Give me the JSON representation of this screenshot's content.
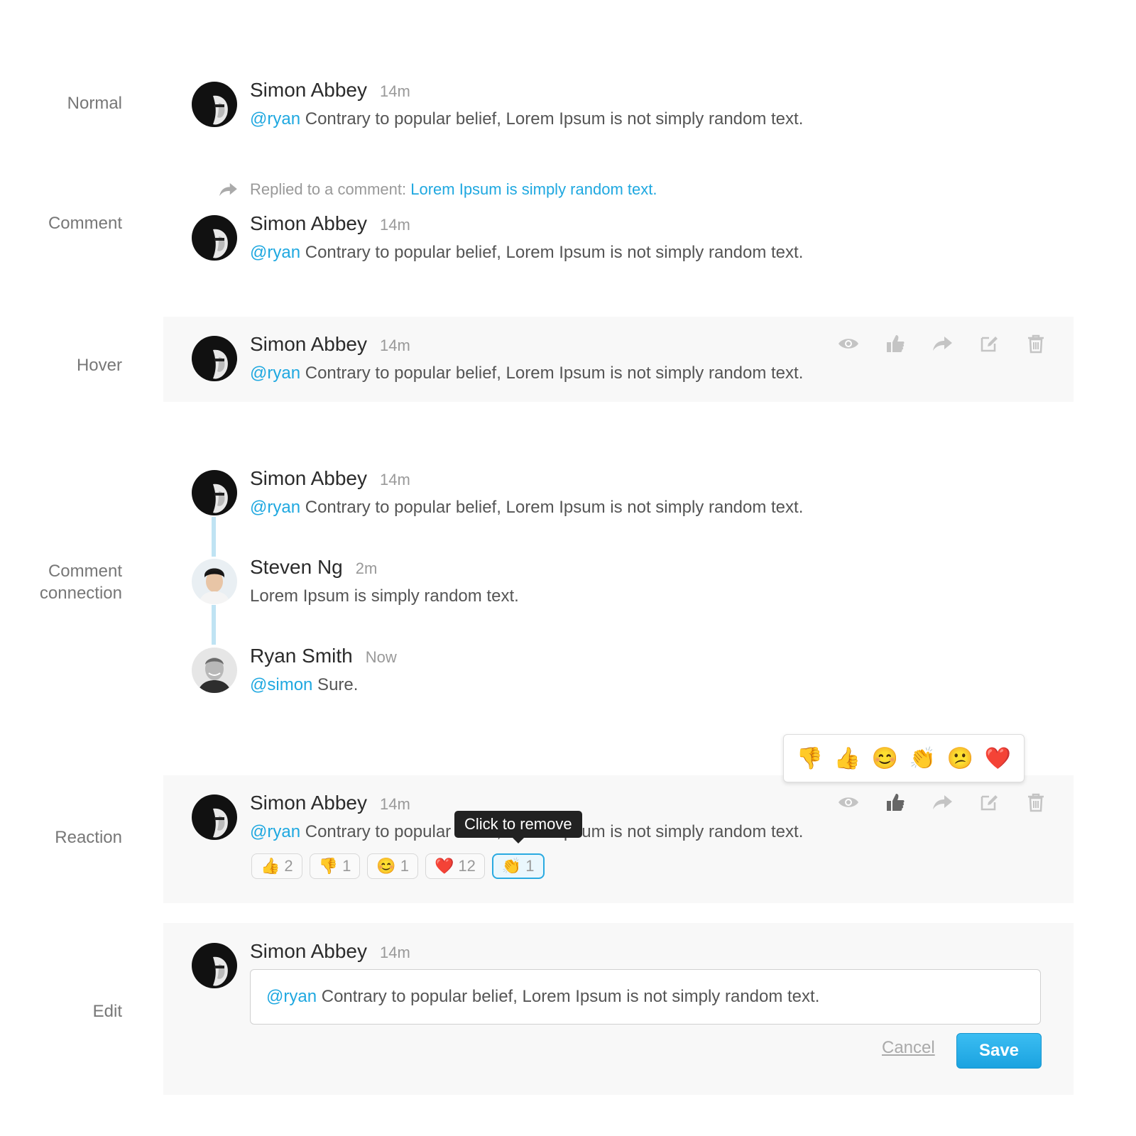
{
  "labels": {
    "normal": "Normal",
    "comment": "Comment",
    "hover": "Hover",
    "connection": "Comment\nconnection",
    "reaction": "Reaction",
    "edit": "Edit"
  },
  "simon": {
    "name": "Simon Abbey",
    "time": "14m",
    "mention": "@ryan",
    "text": " Contrary to popular belief, Lorem Ipsum is not simply random text."
  },
  "reply": {
    "prefix": "Replied to a comment: ",
    "link": "Lorem Ipsum is simply random text."
  },
  "steven": {
    "name": "Steven Ng",
    "time": "2m",
    "text": "Lorem Ipsum is simply random text."
  },
  "ryan": {
    "name": "Ryan Smith",
    "time": "Now",
    "mention": "@simon",
    "text": " Sure."
  },
  "picker": [
    "👎",
    "👍",
    "😊",
    "👏",
    "😕",
    "❤️"
  ],
  "reactions": [
    {
      "emoji": "👍",
      "count": "2"
    },
    {
      "emoji": "👎",
      "count": "1"
    },
    {
      "emoji": "😊",
      "count": "1"
    },
    {
      "emoji": "❤️",
      "count": "12"
    },
    {
      "emoji": "👏",
      "count": "1"
    }
  ],
  "tooltip": "Click to remove",
  "edit": {
    "mention": "@ryan",
    "text": " Contrary to popular belief, Lorem Ipsum is not simply random text.",
    "cancel": "Cancel",
    "save": "Save"
  },
  "colors": {
    "accent": "#1fa8e0",
    "connector": "#bfe3f3"
  }
}
